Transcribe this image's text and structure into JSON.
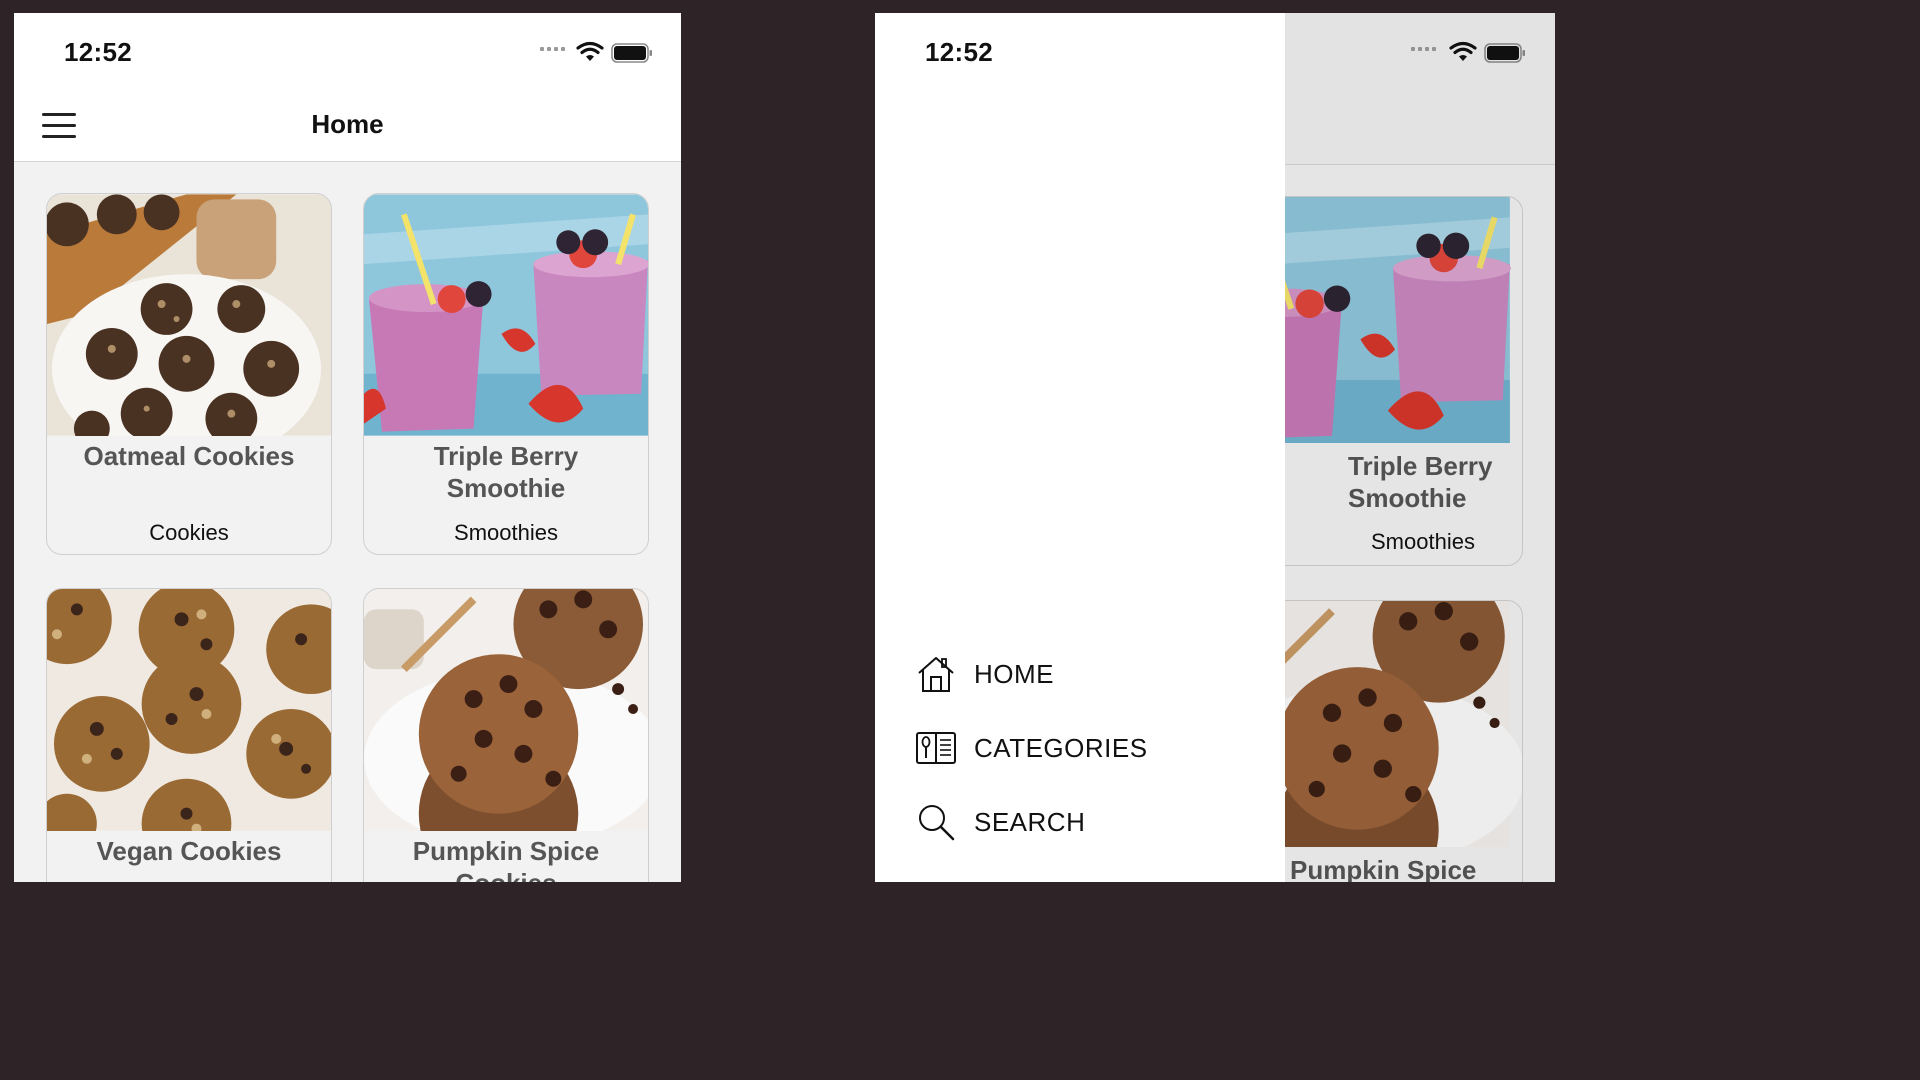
{
  "left_screen": {
    "status_bar": {
      "time": "12:52"
    },
    "nav": {
      "title": "Home"
    },
    "recipes": [
      {
        "title": "Oatmeal Cookies",
        "category": "Cookies",
        "image": "oatmeal-cookies-photo"
      },
      {
        "title": "Triple Berry Smoothie",
        "category": "Smoothies",
        "image": "berry-smoothie-photo"
      },
      {
        "title": "Vegan Cookies",
        "category": "",
        "image": "vegan-cookies-photo"
      },
      {
        "title": "Pumpkin Spice Cookies",
        "category": "",
        "image": "chocolate-chip-cookies-photo"
      }
    ]
  },
  "right_screen": {
    "status_bar": {
      "time": "12:52"
    },
    "menu": {
      "items": [
        {
          "label": "HOME",
          "icon": "home-icon"
        },
        {
          "label": "CATEGORIES",
          "icon": "categories-icon"
        },
        {
          "label": "SEARCH",
          "icon": "search-icon"
        }
      ]
    },
    "recipes": [
      {
        "title": "Triple Berry Smoothie",
        "category": "Smoothies",
        "image": "berry-smoothie-photo"
      },
      {
        "title": "Pumpkin Spice",
        "category": "",
        "image": "chocolate-chip-cookies-photo"
      }
    ]
  },
  "colors": {
    "background": "#2e2326",
    "screen": "#f2f2f2",
    "text": "#111111",
    "card_title": "#555555"
  }
}
